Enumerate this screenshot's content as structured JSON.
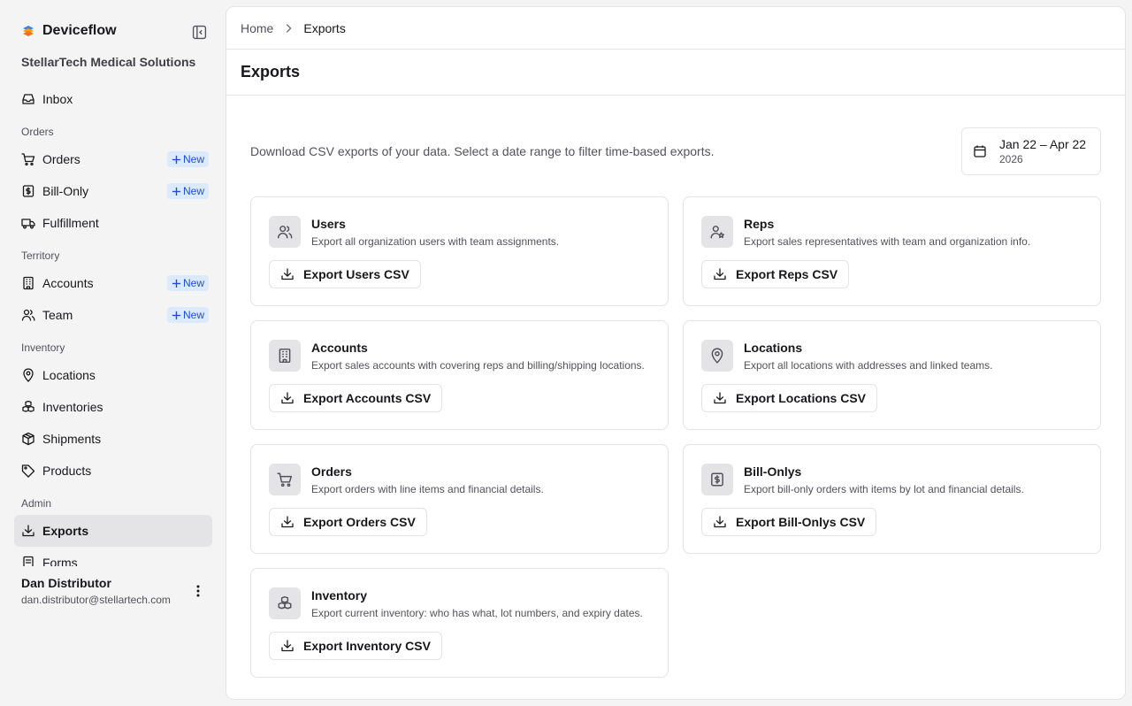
{
  "sidebar": {
    "brand": "Deviceflow",
    "org": "StellarTech Medical Solutions",
    "items": [
      {
        "type": "item",
        "label": "Inbox",
        "icon": "inbox-icon"
      },
      {
        "type": "section",
        "label": "Orders"
      },
      {
        "type": "item",
        "label": "Orders",
        "icon": "cart-icon",
        "badge": "New"
      },
      {
        "type": "item",
        "label": "Bill-Only",
        "icon": "receipt-icon",
        "badge": "New"
      },
      {
        "type": "item",
        "label": "Fulfillment",
        "icon": "truck-icon"
      },
      {
        "type": "section",
        "label": "Territory"
      },
      {
        "type": "item",
        "label": "Accounts",
        "icon": "building-icon",
        "badge": "New"
      },
      {
        "type": "item",
        "label": "Team",
        "icon": "users-icon",
        "badge": "New"
      },
      {
        "type": "section",
        "label": "Inventory"
      },
      {
        "type": "item",
        "label": "Locations",
        "icon": "map-pin-icon"
      },
      {
        "type": "item",
        "label": "Inventories",
        "icon": "boxes-icon"
      },
      {
        "type": "item",
        "label": "Shipments",
        "icon": "package-icon"
      },
      {
        "type": "item",
        "label": "Products",
        "icon": "tag-icon"
      },
      {
        "type": "section",
        "label": "Admin"
      },
      {
        "type": "item",
        "label": "Exports",
        "icon": "download-icon",
        "active": true
      },
      {
        "type": "item",
        "label": "Forms",
        "icon": "form-icon"
      }
    ],
    "user": {
      "name": "Dan Distributor",
      "email": "dan.distributor@stellartech.com"
    }
  },
  "breadcrumb": {
    "home": "Home",
    "current": "Exports"
  },
  "page": {
    "title": "Exports",
    "intro": "Download CSV exports of your data. Select a date range to filter time-based exports.",
    "date_range": "Jan 22 – Apr 22",
    "date_year": "2026"
  },
  "cards": [
    {
      "title": "Users",
      "desc": "Export all organization users with team assignments.",
      "button": "Export Users CSV",
      "icon": "users-icon"
    },
    {
      "title": "Reps",
      "desc": "Export sales representatives with team and organization info.",
      "button": "Export Reps CSV",
      "icon": "user-star-icon"
    },
    {
      "title": "Accounts",
      "desc": "Export sales accounts with covering reps and billing/shipping locations.",
      "button": "Export Accounts CSV",
      "icon": "building-icon"
    },
    {
      "title": "Locations",
      "desc": "Export all locations with addresses and linked teams.",
      "button": "Export Locations CSV",
      "icon": "map-pin-icon"
    },
    {
      "title": "Orders",
      "desc": "Export orders with line items and financial details.",
      "button": "Export Orders CSV",
      "icon": "cart-icon"
    },
    {
      "title": "Bill-Onlys",
      "desc": "Export bill-only orders with items by lot and financial details.",
      "button": "Export Bill-Onlys CSV",
      "icon": "receipt-icon"
    },
    {
      "title": "Inventory",
      "desc": "Export current inventory: who has what, lot numbers, and expiry dates.",
      "button": "Export Inventory CSV",
      "icon": "boxes-icon"
    }
  ],
  "colors": {
    "accent": "#1d4ed8",
    "badge_bg": "#dbeafe",
    "active_bg": "#e4e4e7"
  }
}
